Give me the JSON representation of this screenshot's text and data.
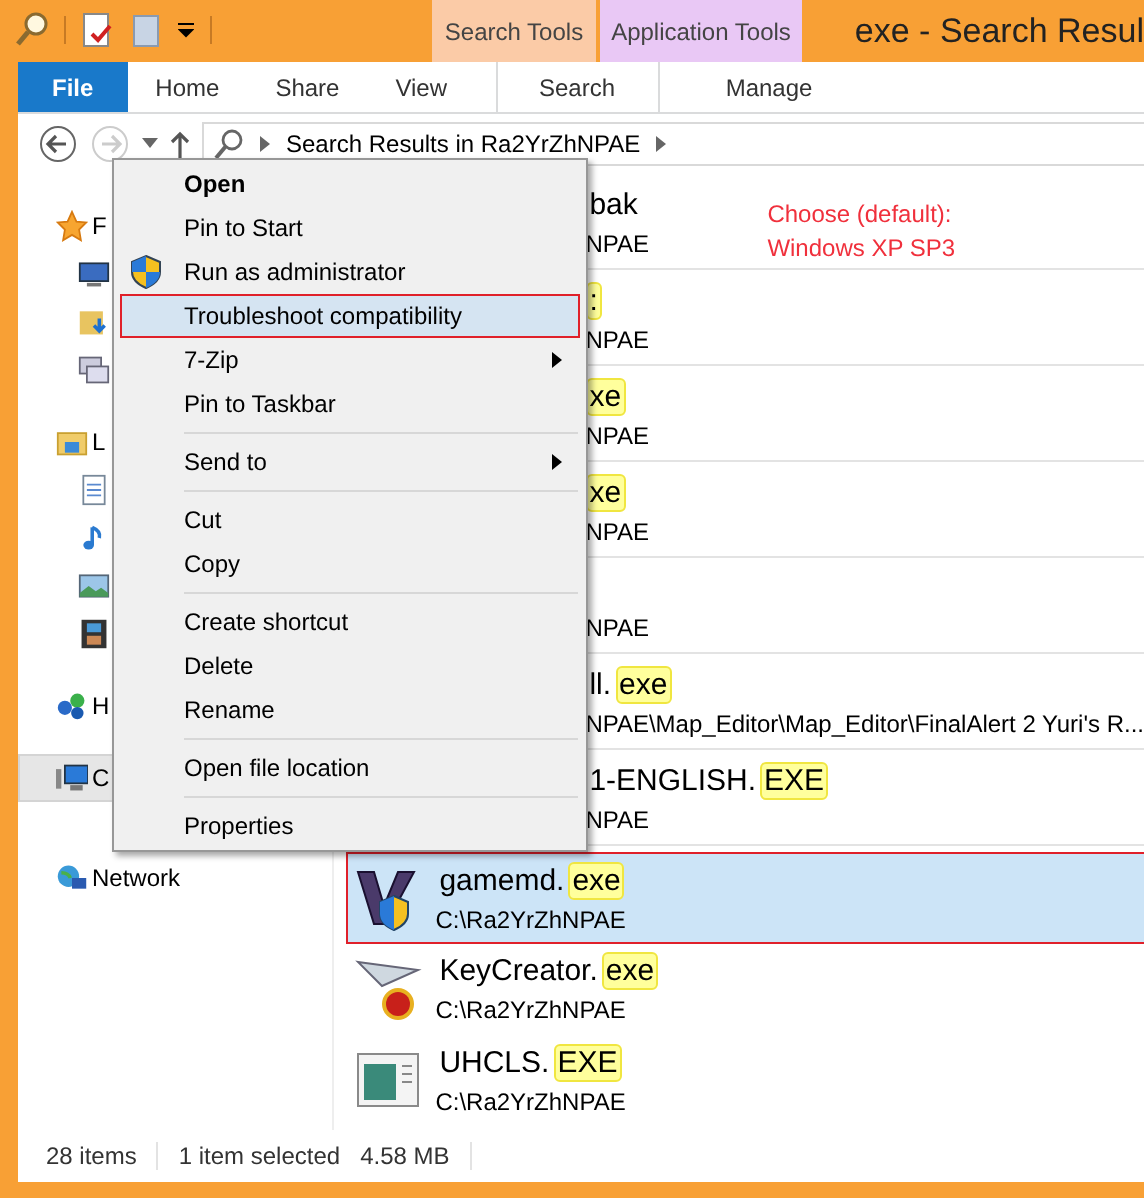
{
  "window": {
    "title": "exe - Search Resul"
  },
  "context_tabs": [
    {
      "group": "Search Tools",
      "tab": "Search",
      "color": "#fbcba7"
    },
    {
      "group": "Application Tools",
      "tab": "Manage",
      "color": "#e9c8f5"
    }
  ],
  "ribbon_tabs": [
    {
      "label": "File",
      "kind": "file"
    },
    {
      "label": "Home",
      "kind": "plain"
    },
    {
      "label": "Share",
      "kind": "plain"
    },
    {
      "label": "View",
      "kind": "plain"
    }
  ],
  "address": {
    "path": "Search Results in Ra2YrZhNPAE"
  },
  "nav_groups": [
    {
      "items": [
        {
          "kind": "star",
          "label": "F",
          "selected": false
        },
        {
          "kind": "desktop",
          "selected": false
        },
        {
          "kind": "downloads",
          "selected": false
        },
        {
          "kind": "recent",
          "selected": false
        }
      ]
    },
    {
      "items": [
        {
          "kind": "library",
          "label": "L",
          "selected": false
        },
        {
          "kind": "document",
          "selected": false
        },
        {
          "kind": "music",
          "selected": false
        },
        {
          "kind": "picture",
          "selected": false
        },
        {
          "kind": "video",
          "selected": false
        }
      ]
    },
    {
      "items": [
        {
          "kind": "homegroup",
          "label": "H",
          "selected": false
        }
      ]
    },
    {
      "items": [
        {
          "kind": "computer",
          "label": "C",
          "selected": true
        }
      ]
    },
    {
      "items": [
        {
          "kind": "network",
          "label": "Network",
          "selected": false
        }
      ]
    }
  ],
  "results": [
    {
      "kind": "clipped",
      "name": [
        {
          "text": "bak",
          "match": false
        }
      ],
      "path": "NPAE",
      "selected": false
    },
    {
      "kind": "clipped",
      "name": [
        {
          "text": ":",
          "match": true
        }
      ],
      "path": "NPAE",
      "selected": false
    },
    {
      "kind": "clipped",
      "name": [
        {
          "text": "xe",
          "match": true
        }
      ],
      "path": "NPAE",
      "selected": false
    },
    {
      "kind": "clipped",
      "name": [
        {
          "text": "xe",
          "match": true
        }
      ],
      "path": "NPAE",
      "selected": false
    },
    {
      "kind": "clipped",
      "path": "NPAE",
      "selected": false
    },
    {
      "kind": "clipped",
      "name": [
        {
          "text": "ll.",
          "match": false
        },
        {
          "text": "exe",
          "match": true
        }
      ],
      "path": "NPAE\\Map_Editor\\Map_Editor\\FinalAlert 2 Yuri's R...",
      "selected": false
    },
    {
      "kind": "clipped",
      "name": [
        {
          "text": "1-ENGLISH.",
          "match": false
        },
        {
          "text": "EXE",
          "match": true
        }
      ],
      "path": "NPAE",
      "selected": false
    },
    {
      "kind": "game",
      "name": [
        {
          "text": "gamemd.",
          "match": false
        },
        {
          "text": "exe",
          "match": true
        }
      ],
      "path": "C:\\Ra2YrZhNPAE",
      "selected": true
    },
    {
      "kind": "key",
      "name": [
        {
          "text": "KeyCreator.",
          "match": false
        },
        {
          "text": "exe",
          "match": true
        }
      ],
      "path": "C:\\Ra2YrZhNPAE",
      "selected": false
    },
    {
      "kind": "app",
      "name": [
        {
          "text": "UHCLS.",
          "match": false
        },
        {
          "text": "EXE",
          "match": true
        }
      ],
      "path": "C:\\Ra2YrZhNPAE",
      "selected": false
    }
  ],
  "annotation": "Choose (default):\nWindows XP SP3",
  "context_menu": [
    {
      "kind": "item",
      "label": "Open",
      "bold": true,
      "highlighted": false
    },
    {
      "kind": "item",
      "label": "Pin to Start",
      "highlighted": false
    },
    {
      "kind": "elevated",
      "label": "Run as administrator",
      "highlighted": false
    },
    {
      "kind": "item",
      "label": "Troubleshoot compatibility",
      "highlighted": true
    },
    {
      "kind": "item",
      "label": "7-Zip",
      "submenu": true,
      "highlighted": false
    },
    {
      "kind": "item",
      "label": "Pin to Taskbar",
      "highlighted": false
    },
    {
      "kind": "separator"
    },
    {
      "kind": "item",
      "label": "Send to",
      "submenu": true,
      "highlighted": false
    },
    {
      "kind": "separator"
    },
    {
      "kind": "item",
      "label": "Cut",
      "highlighted": false
    },
    {
      "kind": "item",
      "label": "Copy",
      "highlighted": false
    },
    {
      "kind": "separator"
    },
    {
      "kind": "item",
      "label": "Create shortcut",
      "highlighted": false
    },
    {
      "kind": "item",
      "label": "Delete",
      "highlighted": false
    },
    {
      "kind": "item",
      "label": "Rename",
      "highlighted": false
    },
    {
      "kind": "separator"
    },
    {
      "kind": "item",
      "label": "Open file location",
      "highlighted": false
    },
    {
      "kind": "separator"
    },
    {
      "kind": "item",
      "label": "Properties",
      "highlighted": false
    }
  ],
  "status_bar": {
    "count": "28 items",
    "selection": "1 item selected",
    "size": "4.58 MB"
  }
}
